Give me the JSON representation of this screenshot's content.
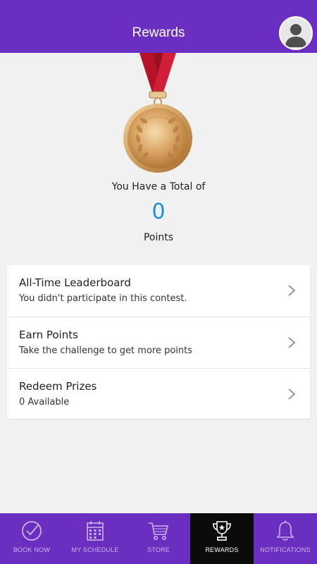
{
  "header": {
    "title": "Rewards"
  },
  "summary": {
    "total_label": "You Have a Total of",
    "points_value": "0",
    "points_label": "Points"
  },
  "menu": {
    "items": [
      {
        "title": "All-Time Leaderboard",
        "subtitle": "You didn't participate in this contest."
      },
      {
        "title": "Earn Points",
        "subtitle": "Take the challenge to get more points"
      },
      {
        "title": "Redeem Prizes",
        "subtitle": "0 Available"
      }
    ]
  },
  "tabbar": {
    "tabs": [
      {
        "label": "BOOK NOW",
        "icon": "check-circle-icon"
      },
      {
        "label": "MY SCHEDULE",
        "icon": "calendar-icon"
      },
      {
        "label": "STORE",
        "icon": "cart-icon"
      },
      {
        "label": "REWARDS",
        "icon": "trophy-icon",
        "active": true
      },
      {
        "label": "NOTIFICATIONS",
        "icon": "bell-icon"
      }
    ]
  },
  "colors": {
    "brand": "#6a2fc0",
    "points": "#1e8ed6",
    "active_tab": "#0a0a0a"
  }
}
